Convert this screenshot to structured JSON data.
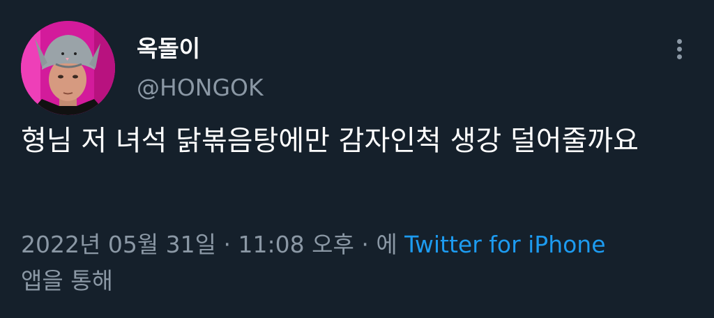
{
  "tweet": {
    "author": {
      "display_name": "옥돌이",
      "handle": "@HONGOK"
    },
    "text": "형님 저 녀석 닭볶음탕에만 감자인척 생강 덜어줄까요",
    "meta": {
      "date": "2022년 05월 31일",
      "separator1": " · ",
      "time": "11:08 오후",
      "separator2": " · ",
      "via_prefix": "에 ",
      "source": "Twitter for iPhone",
      "via_suffix": "앱을 통해"
    }
  },
  "colors": {
    "background": "#15202b",
    "text": "#ffffff",
    "secondary": "#8b98a5",
    "link": "#1d9bf0"
  },
  "icons": {
    "more": "more-vertical-icon"
  }
}
